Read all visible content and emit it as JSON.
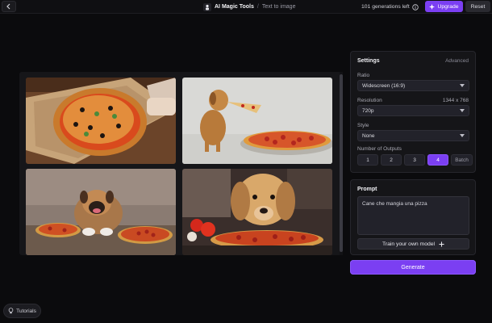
{
  "header": {
    "app_title": "AI Magic Tools",
    "separator": "/",
    "page_title": "Text to image",
    "generations_left": "101 generations left",
    "upgrade_label": "Upgrade",
    "reset_label": "Reset"
  },
  "gallery": {
    "images": [
      {
        "subject": "pizza-on-box"
      },
      {
        "subject": "dog-eating-pizza-slice"
      },
      {
        "subject": "bulldog-with-pizza"
      },
      {
        "subject": "dog-with-pizza-closeup"
      }
    ]
  },
  "settings": {
    "title": "Settings",
    "advanced_label": "Advanced",
    "ratio_label": "Ratio",
    "ratio_value": "Widescreen (16:9)",
    "resolution_label": "Resolution",
    "resolution_dims": "1344 x 768",
    "resolution_value": "720p",
    "style_label": "Style",
    "style_value": "None",
    "outputs_label": "Number of Outputs",
    "outputs": [
      "1",
      "2",
      "3",
      "4"
    ],
    "outputs_selected": "4",
    "batch_label": "Batch"
  },
  "prompt": {
    "title": "Prompt",
    "value": "Cane che mangia una pizza",
    "train_label": "Train your own model"
  },
  "generate_label": "Generate",
  "tutorials_label": "Tutorials",
  "colors": {
    "accent": "#7b3ff2",
    "background": "#0b0b0d",
    "panel": "#151518"
  }
}
